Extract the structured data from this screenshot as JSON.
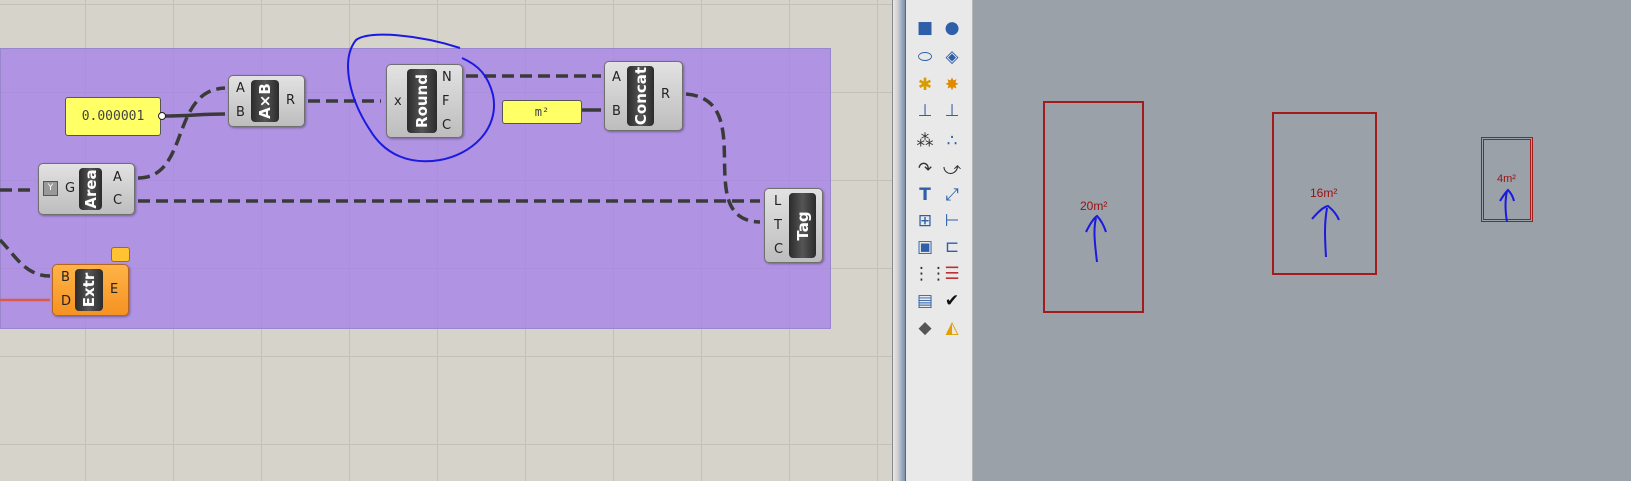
{
  "canvas": {
    "panel_value": "0.000001",
    "unit_panel": "m²",
    "components": {
      "area": {
        "name": "Area",
        "inputs": [
          "G"
        ],
        "outputs": [
          "A",
          "C"
        ]
      },
      "multiply": {
        "name": "A×B",
        "inputs": [
          "A",
          "B"
        ],
        "outputs": [
          "R"
        ]
      },
      "round": {
        "name": "Round",
        "inputs": [
          "x"
        ],
        "outputs": [
          "N",
          "F",
          "C"
        ]
      },
      "concat": {
        "name": "Concat",
        "inputs": [
          "A",
          "B"
        ],
        "outputs": [
          "R"
        ]
      },
      "tag": {
        "name": "Tag",
        "inputs": [
          "L",
          "T",
          "C"
        ],
        "outputs": []
      },
      "extrude": {
        "name": "Extr",
        "inputs": [
          "B",
          "D"
        ],
        "outputs": [
          "E"
        ]
      }
    }
  },
  "toolbar": {
    "icons": [
      "cube-icon",
      "spheres-icon",
      "cylinder-icon",
      "surface-icon",
      "gear-star-icon",
      "explode-icon",
      "split-icon",
      "trim-icon",
      "sphere-cluster-icon",
      "points-icon",
      "arc-icon",
      "fillet-icon",
      "text-icon",
      "scale-icon",
      "array-icon",
      "dimension-icon",
      "box-render-icon",
      "ruler-icon",
      "grid-icon",
      "stack-icon",
      "clipboard-icon",
      "check-icon",
      "solids-icon",
      "paint-icon"
    ]
  },
  "viewport": {
    "labels": [
      "20m²",
      "16m²",
      "4m²"
    ],
    "rect_color": "#a31c1c",
    "label_color": "#9b1010"
  },
  "annotation_color": "#1a1ae0"
}
